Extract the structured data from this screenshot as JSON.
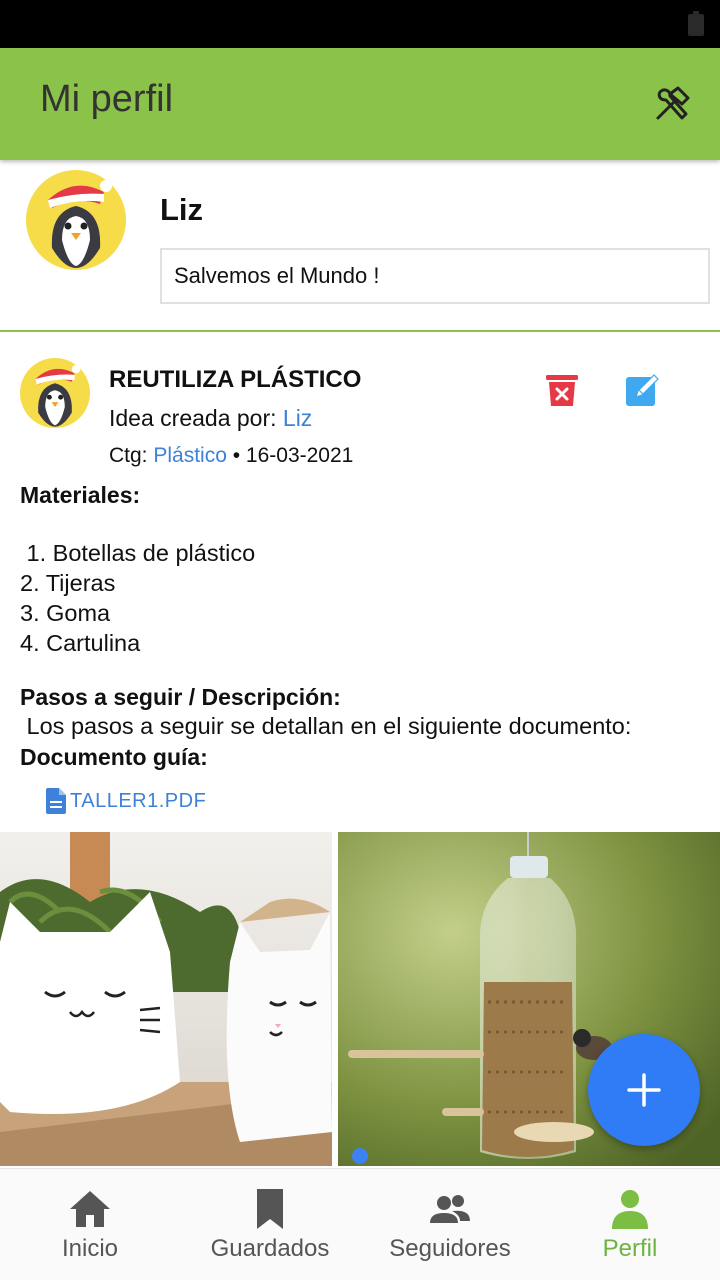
{
  "app": {
    "title": "Mi perfil"
  },
  "profile": {
    "name": "Liz",
    "bio": "Salvemos el Mundo !"
  },
  "post": {
    "title": "REUTILIZA PLÁSTICO",
    "created_by_label": "Idea creada por: ",
    "author": "Liz",
    "category_label": "Ctg: ",
    "category": "Plástico",
    "date_sep": " • ",
    "date": "16-03-2021",
    "materials_heading": "Materiales:",
    "materials": [
      " 1. Botellas de plástico",
      "2. Tijeras",
      "3. Goma",
      "4. Cartulina"
    ],
    "steps_heading": "Pasos a seguir / Descripción:",
    "steps_text": " Los pasos a seguir se detallan en el siguiente documento:",
    "guide_heading": "Documento guía:",
    "guide_file": "TALLER1.PDF"
  },
  "nav": [
    {
      "label": "Inicio",
      "icon": "home-icon"
    },
    {
      "label": "Guardados",
      "icon": "bookmark-icon"
    },
    {
      "label": "Seguidores",
      "icon": "people-icon"
    },
    {
      "label": "Perfil",
      "icon": "person-icon",
      "active": true
    }
  ],
  "colors": {
    "appbar": "#8bc34a",
    "link": "#3d82d8",
    "fab": "#2f7cf6",
    "delete": "#e53945",
    "edit": "#3fa9ef",
    "nav_active": "#6db33f"
  }
}
